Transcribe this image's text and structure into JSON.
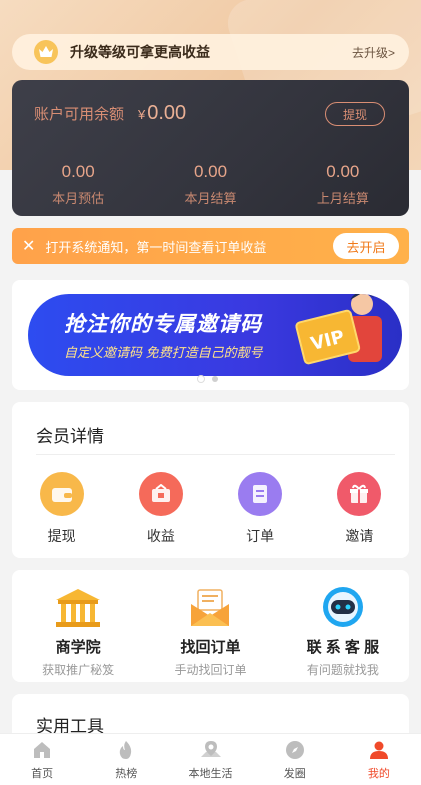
{
  "colors": {
    "accent": "#f04a2a",
    "gold": "#e7a58a",
    "notify_orange": "#ffa24a",
    "banner_blue": "#2d4cf0"
  },
  "upgrade": {
    "icon": "crown-icon",
    "text": "升级等级可拿更高收益",
    "link": "去升级>"
  },
  "account": {
    "balance_label": "账户可用余额",
    "currency": "¥",
    "balance_value": "0.00",
    "withdraw_label": "提现",
    "stats": [
      {
        "value": "0.00",
        "label": "本月预估"
      },
      {
        "value": "0.00",
        "label": "本月结算"
      },
      {
        "value": "0.00",
        "label": "上月结算"
      }
    ]
  },
  "notify": {
    "close_icon": "close-icon",
    "text": "打开系统通知，第一时间查看订单收益",
    "button": "去开启"
  },
  "banner": {
    "title": "抢注你的专属邀请码",
    "subtitle": "自定义邀请码 免费打造自己的靓号",
    "badge": "VIP",
    "pages": 2,
    "active_page": 1
  },
  "member": {
    "title": "会员详情",
    "items": [
      {
        "label": "提现",
        "icon": "wallet-icon",
        "color": "#f8b84a"
      },
      {
        "label": "收益",
        "icon": "income-icon",
        "color": "#f56a5a"
      },
      {
        "label": "订单",
        "icon": "order-icon",
        "color": "#9a7cf0"
      },
      {
        "label": "邀请",
        "icon": "gift-icon",
        "color": "#f05a6a"
      }
    ]
  },
  "tools": [
    {
      "title": "商学院",
      "subtitle": "获取推广秘笈",
      "icon": "academy-icon"
    },
    {
      "title": "找回订单",
      "subtitle": "手动找回订单",
      "icon": "mail-icon"
    },
    {
      "title": "联 系 客 服",
      "subtitle": "有问题就找我",
      "icon": "robot-icon"
    }
  ],
  "utilities": {
    "title": "实用工具"
  },
  "tabbar": {
    "items": [
      {
        "label": "首页",
        "icon": "home-icon"
      },
      {
        "label": "热榜",
        "icon": "flame-icon"
      },
      {
        "label": "本地生活",
        "icon": "location-icon"
      },
      {
        "label": "发圈",
        "icon": "compass-icon"
      },
      {
        "label": "我的",
        "icon": "user-icon"
      }
    ],
    "active_index": 4
  }
}
